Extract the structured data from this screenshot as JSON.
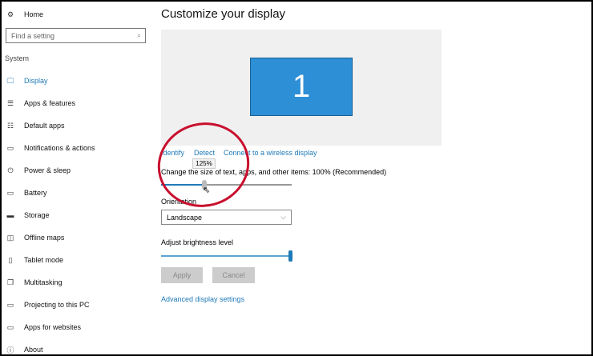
{
  "sidebar": {
    "home": "Home",
    "search_placeholder": "Find a setting",
    "section": "System",
    "items": [
      {
        "label": "Display",
        "icon": "monitor-icon",
        "glyph": "🖵"
      },
      {
        "label": "Apps & features",
        "icon": "list-icon",
        "glyph": "☰"
      },
      {
        "label": "Default apps",
        "icon": "default-apps-icon",
        "glyph": "☷"
      },
      {
        "label": "Notifications & actions",
        "icon": "notification-icon",
        "glyph": "▭"
      },
      {
        "label": "Power & sleep",
        "icon": "power-icon",
        "glyph": "⏻"
      },
      {
        "label": "Battery",
        "icon": "battery-icon",
        "glyph": "▭"
      },
      {
        "label": "Storage",
        "icon": "storage-icon",
        "glyph": "▬"
      },
      {
        "label": "Offline maps",
        "icon": "map-icon",
        "glyph": "◫"
      },
      {
        "label": "Tablet mode",
        "icon": "tablet-icon",
        "glyph": "▯"
      },
      {
        "label": "Multitasking",
        "icon": "multitasking-icon",
        "glyph": "❐"
      },
      {
        "label": "Projecting to this PC",
        "icon": "projecting-icon",
        "glyph": "▭"
      },
      {
        "label": "Apps for websites",
        "icon": "apps-websites-icon",
        "glyph": "▭"
      },
      {
        "label": "About",
        "icon": "info-icon",
        "glyph": "ⓘ"
      }
    ]
  },
  "main": {
    "title": "Customize your display",
    "monitor_number": "1",
    "links": {
      "identify": "Identify",
      "detect": "Detect",
      "connect": "Connect to a wireless display",
      "advanced": "Advanced display settings"
    },
    "scale_label": "Change the size of text, apps, and other items: 100% (Recommended)",
    "scale_tooltip": "125%",
    "scale_value": 0.33,
    "orientation_label": "Orientation",
    "orientation_value": "Landscape",
    "brightness_label": "Adjust brightness level",
    "brightness_value": 1.0,
    "apply": "Apply",
    "cancel": "Cancel"
  },
  "colors": {
    "accent": "#1f7ab8",
    "monitor": "#2d8fd5",
    "annotation": "#c8102e"
  }
}
